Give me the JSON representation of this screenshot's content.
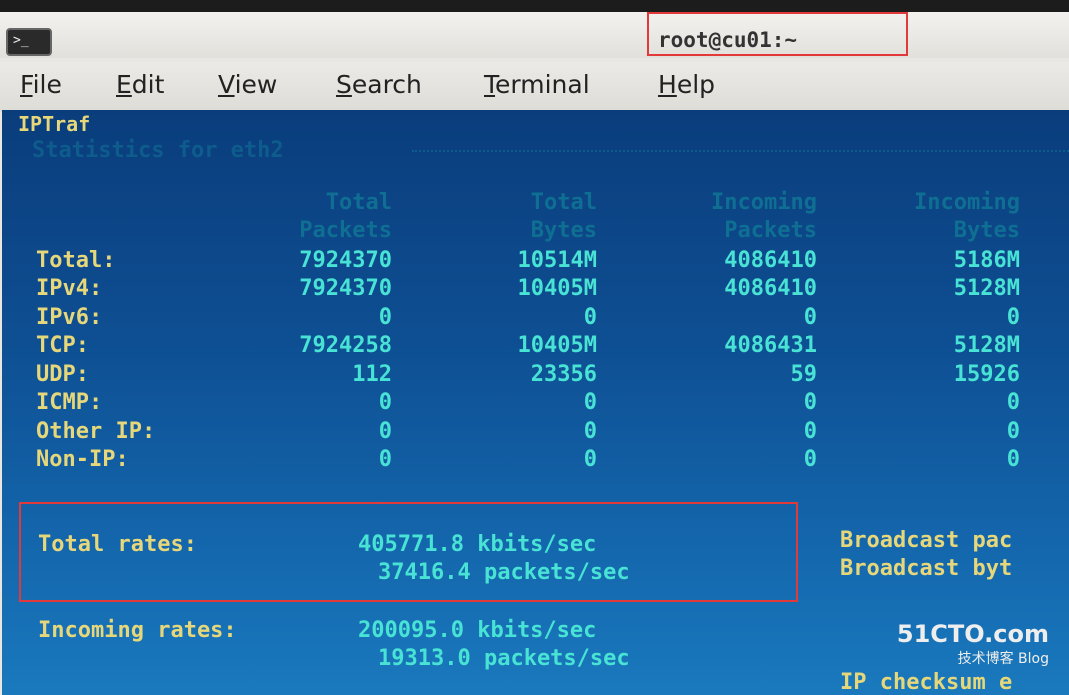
{
  "window": {
    "title": "root@cu01:~",
    "icon": "terminal-icon",
    "icon_glyph": ">_"
  },
  "menu": [
    {
      "first": "F",
      "rest": "ile"
    },
    {
      "first": "E",
      "rest": "dit"
    },
    {
      "first": "V",
      "rest": "iew"
    },
    {
      "first": "S",
      "rest": "earch"
    },
    {
      "first": "T",
      "rest": "erminal"
    },
    {
      "first": "H",
      "rest": "elp"
    }
  ],
  "terminal": {
    "app_title": "IPTraf",
    "stats_title": "Statistics for eth2",
    "columns": [
      {
        "line1": "Total",
        "line2": "Packets"
      },
      {
        "line1": "Total",
        "line2": "Bytes"
      },
      {
        "line1": "Incoming",
        "line2": "Packets"
      },
      {
        "line1": "Incoming",
        "line2": "Bytes"
      }
    ],
    "rows": [
      {
        "label": "Total:",
        "values": [
          "7924370",
          "10514M",
          "4086410",
          "5186M"
        ]
      },
      {
        "label": "IPv4:",
        "values": [
          "7924370",
          "10405M",
          "4086410",
          "5128M"
        ]
      },
      {
        "label": "IPv6:",
        "values": [
          "0",
          "0",
          "0",
          "0"
        ]
      },
      {
        "label": "TCP:",
        "values": [
          "7924258",
          "10405M",
          "4086431",
          "5128M"
        ]
      },
      {
        "label": "UDP:",
        "values": [
          "112",
          "23356",
          "59",
          "15926"
        ]
      },
      {
        "label": "ICMP:",
        "values": [
          "0",
          "0",
          "0",
          "0"
        ]
      },
      {
        "label": "Other IP:",
        "values": [
          "0",
          "0",
          "0",
          "0"
        ]
      },
      {
        "label": "Non-IP:",
        "values": [
          "0",
          "0",
          "0",
          "0"
        ]
      }
    ],
    "total_rates": {
      "label": "Total rates:",
      "kbits": "405771.8 kbits/sec",
      "packets": "37416.4 packets/sec"
    },
    "incoming_rates": {
      "label": "Incoming rates:",
      "kbits": "200095.0 kbits/sec",
      "packets": "19313.0 packets/sec"
    },
    "broadcast_lines": [
      "Broadcast pac",
      "Broadcast byt"
    ],
    "ip_checksum": "IP checksum e"
  },
  "watermark": {
    "brand": "51CTO.com",
    "sub": "技术博客",
    "blog": "Blog"
  },
  "colors": {
    "highlight_box": "#e23a3a",
    "terminal_bg": "#0e4f93",
    "label_yellow": "#e6d77a",
    "value_cyan": "#48e3d4"
  }
}
